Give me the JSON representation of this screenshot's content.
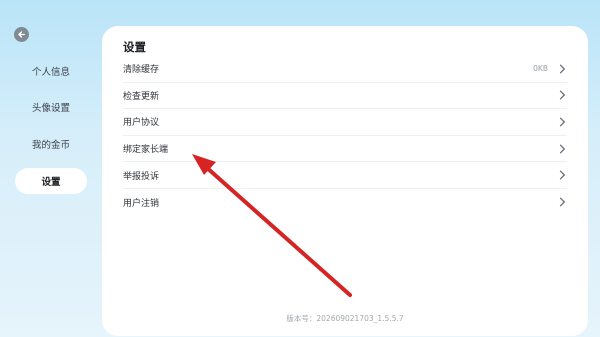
{
  "sidebar": {
    "items": [
      {
        "label": "个人信息",
        "active": false
      },
      {
        "label": "头像设置",
        "active": false
      },
      {
        "label": "我的金币",
        "active": false
      },
      {
        "label": "设置",
        "active": true
      }
    ]
  },
  "panel": {
    "title": "设置",
    "rows": [
      {
        "label": "清除缓存",
        "value": "0KB"
      },
      {
        "label": "检查更新",
        "value": ""
      },
      {
        "label": "用户协议",
        "value": ""
      },
      {
        "label": "绑定家长端",
        "value": ""
      },
      {
        "label": "举报投诉",
        "value": ""
      },
      {
        "label": "用户注销",
        "value": ""
      }
    ],
    "version": "版本号：202609021703_1.5.5.7"
  },
  "icons": {
    "back": "back-arrow-icon",
    "chevron": "chevron-right-icon"
  },
  "colors": {
    "annotation_arrow": "#d62424",
    "background_top": "#b9e4f8",
    "background_bottom": "#e6f4fb"
  }
}
